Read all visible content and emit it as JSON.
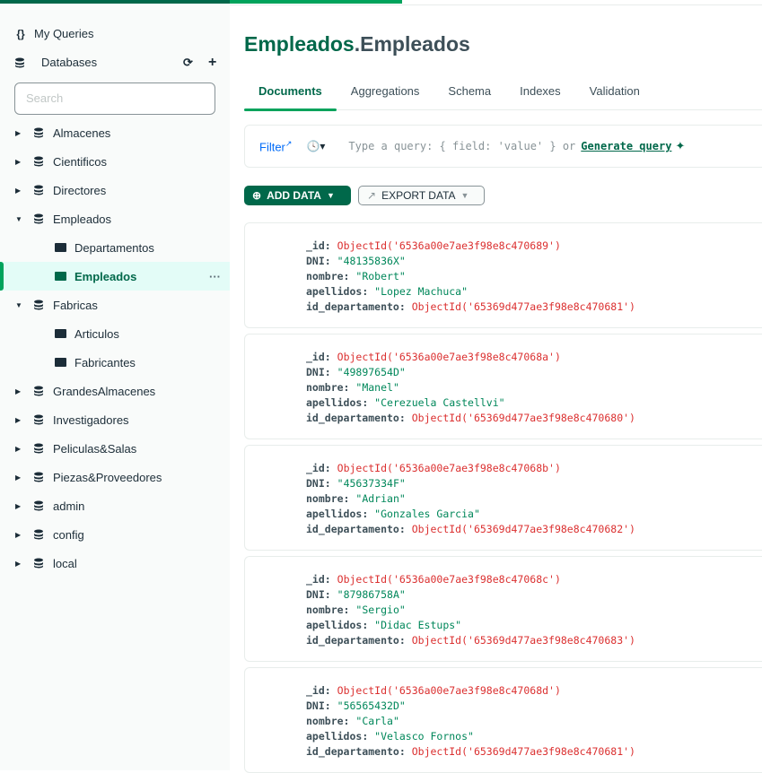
{
  "sidebar": {
    "my_queries": "My Queries",
    "databases": "Databases",
    "search_placeholder": "Search",
    "tree": [
      {
        "label": "Almacenes",
        "type": "db",
        "expanded": false
      },
      {
        "label": "Cientificos",
        "type": "db",
        "expanded": false
      },
      {
        "label": "Directores",
        "type": "db",
        "expanded": false
      },
      {
        "label": "Empleados",
        "type": "db",
        "expanded": true
      },
      {
        "label": "Departamentos",
        "type": "collection"
      },
      {
        "label": "Empleados",
        "type": "collection",
        "selected": true
      },
      {
        "label": "Fabricas",
        "type": "db",
        "expanded": true
      },
      {
        "label": "Articulos",
        "type": "collection"
      },
      {
        "label": "Fabricantes",
        "type": "collection"
      },
      {
        "label": "GrandesAlmacenes",
        "type": "db",
        "expanded": false
      },
      {
        "label": "Investigadores",
        "type": "db",
        "expanded": false
      },
      {
        "label": "Peliculas&Salas",
        "type": "db",
        "expanded": false
      },
      {
        "label": "Piezas&Proveedores",
        "type": "db",
        "expanded": false
      },
      {
        "label": "admin",
        "type": "db",
        "expanded": false
      },
      {
        "label": "config",
        "type": "db",
        "expanded": false
      },
      {
        "label": "local",
        "type": "db",
        "expanded": false
      }
    ]
  },
  "header": {
    "db": "Empleados",
    "collection": ".Empleados"
  },
  "tabs": [
    "Documents",
    "Aggregations",
    "Schema",
    "Indexes",
    "Validation"
  ],
  "filter": {
    "label": "Filter",
    "placeholder": "Type a query: { field: 'value' } or",
    "generate": "Generate query"
  },
  "toolbar": {
    "add_data": "ADD DATA",
    "export_data": "EXPORT DATA"
  },
  "documents": [
    {
      "_id": "ObjectId('6536a00e7ae3f98e8c470689')",
      "DNI": "\"48135836X\"",
      "nombre": "\"Robert\"",
      "apellidos": "\"Lopez Machuca\"",
      "id_departamento": "ObjectId('65369d477ae3f98e8c470681')"
    },
    {
      "_id": "ObjectId('6536a00e7ae3f98e8c47068a')",
      "DNI": "\"49897654D\"",
      "nombre": "\"Manel\"",
      "apellidos": "\"Cerezuela Castellvi\"",
      "id_departamento": "ObjectId('65369d477ae3f98e8c470680')"
    },
    {
      "_id": "ObjectId('6536a00e7ae3f98e8c47068b')",
      "DNI": "\"45637334F\"",
      "nombre": "\"Adrian\"",
      "apellidos": "\"Gonzales Garcia\"",
      "id_departamento": "ObjectId('65369d477ae3f98e8c470682')"
    },
    {
      "_id": "ObjectId('6536a00e7ae3f98e8c47068c')",
      "DNI": "\"87986758A\"",
      "nombre": "\"Sergio\"",
      "apellidos": "\"Didac Estups\"",
      "id_departamento": "ObjectId('65369d477ae3f98e8c470683')"
    },
    {
      "_id": "ObjectId('6536a00e7ae3f98e8c47068d')",
      "DNI": "\"56565432D\"",
      "nombre": "\"Carla\"",
      "apellidos": "\"Velasco Fornos\"",
      "id_departamento": "ObjectId('65369d477ae3f98e8c470681')"
    }
  ],
  "colors": {
    "accent": "#00684a",
    "highlight": "#00a35c",
    "objectid": "#db3030",
    "string": "#00875a"
  }
}
